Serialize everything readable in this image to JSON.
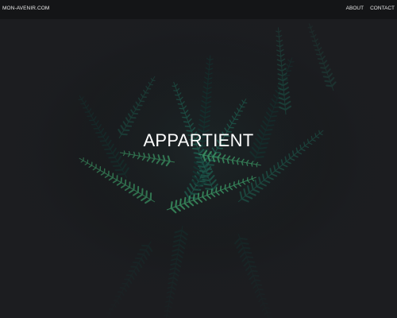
{
  "navbar": {
    "brand": "MON-AVENIR.COM",
    "links": [
      {
        "label": "ABOUT"
      },
      {
        "label": "CONTACT"
      }
    ]
  },
  "hero": {
    "title": "APPARTIENT",
    "background_image": "dark-tropical-fern-leaves"
  },
  "colors": {
    "navbar_bg": "#141517",
    "page_bg": "#1f2023",
    "foliage_dark": "#153633",
    "foliage_mid": "#1f5a4d",
    "foliage_bright": "#3f9f6a",
    "text": "#ffffff"
  }
}
